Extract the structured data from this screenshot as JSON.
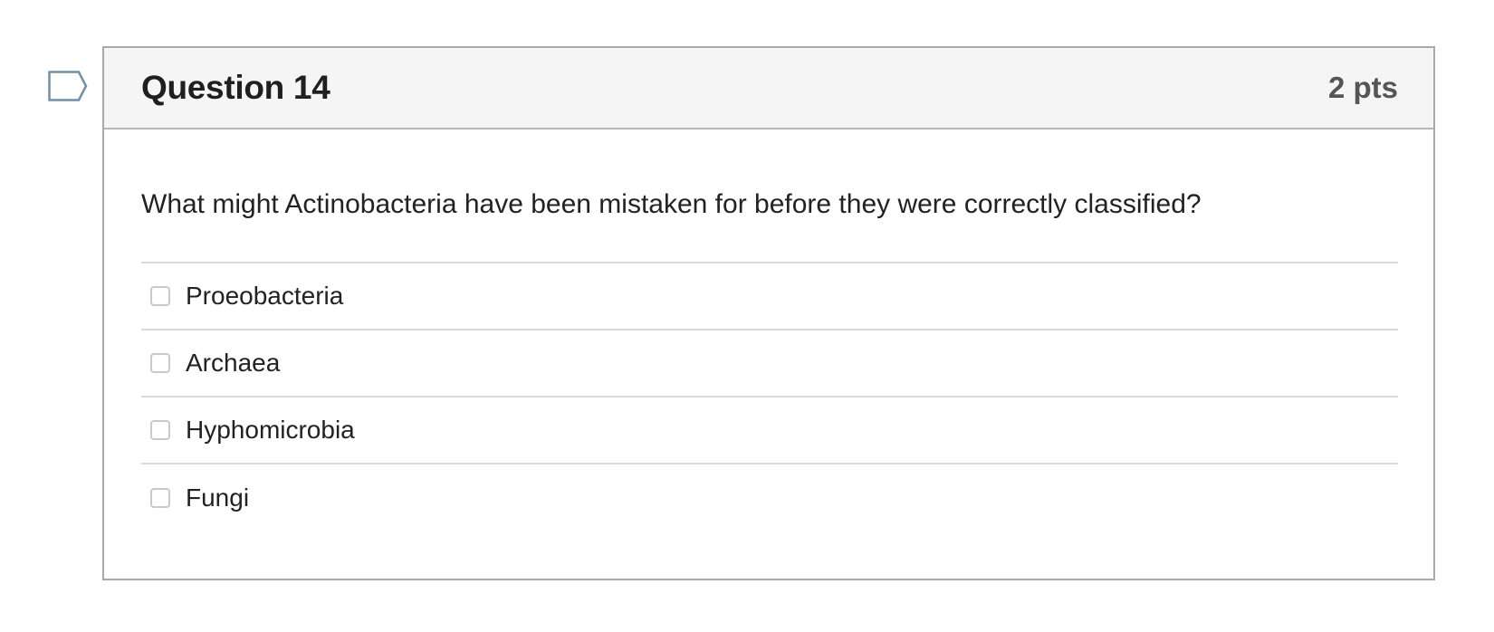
{
  "flag": {
    "icon": "flag-question-icon",
    "stroke_color": "#6f90a8"
  },
  "question": {
    "title": "Question 14",
    "points": "2 pts",
    "text": "What might Actinobacteria have been mistaken for before they were correctly classified?"
  },
  "answers": [
    {
      "label": "Proeobacteria",
      "checked": false
    },
    {
      "label": "Archaea",
      "checked": false
    },
    {
      "label": "Hyphomicrobia",
      "checked": false
    },
    {
      "label": "Fungi",
      "checked": false
    }
  ],
  "colors": {
    "header_bg": "#f5f5f5",
    "card_border": "#a9a9a9",
    "divider": "#dadada",
    "title_text": "#1f1f1f",
    "points_text": "#555555"
  }
}
